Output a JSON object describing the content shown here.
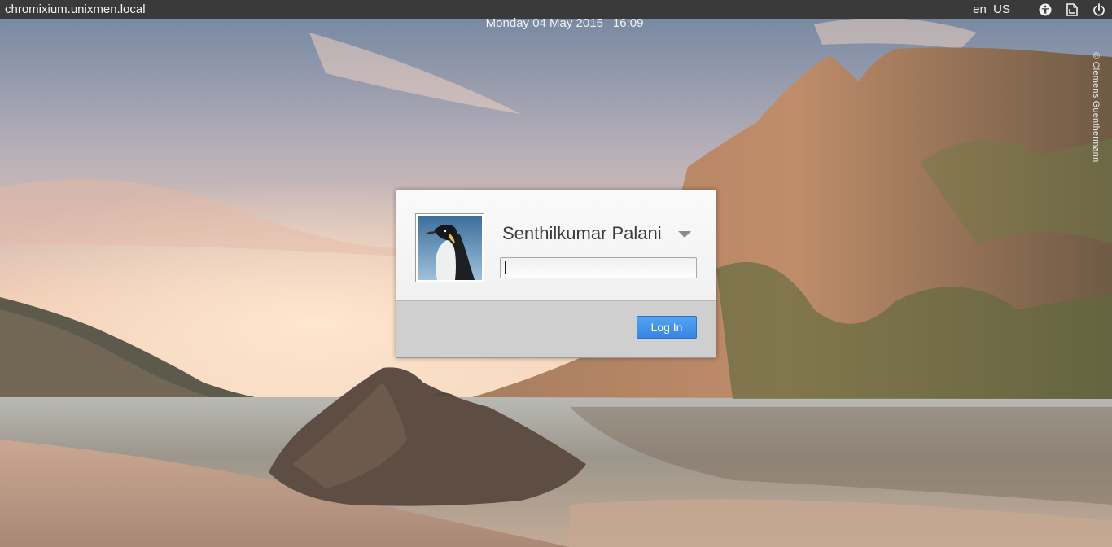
{
  "panel": {
    "hostname": "chromixium.unixmen.local",
    "date": "Monday 04 May 2015",
    "time": "16:09",
    "language": "en_US",
    "icons": [
      "accessibility-icon",
      "keyboard-layout-icon",
      "power-icon"
    ]
  },
  "wallpaper": {
    "credit": "© Clemens Guenthermann"
  },
  "login": {
    "user_name": "Senthilkumar Palani",
    "avatar_icon": "penguin-avatar-icon",
    "password_value": "",
    "login_label": "Log In"
  },
  "colors": {
    "panel_bg": "#3a3a3a",
    "button_accent": "#3f8ee6",
    "dialog_footer": "#cfcfcf"
  }
}
